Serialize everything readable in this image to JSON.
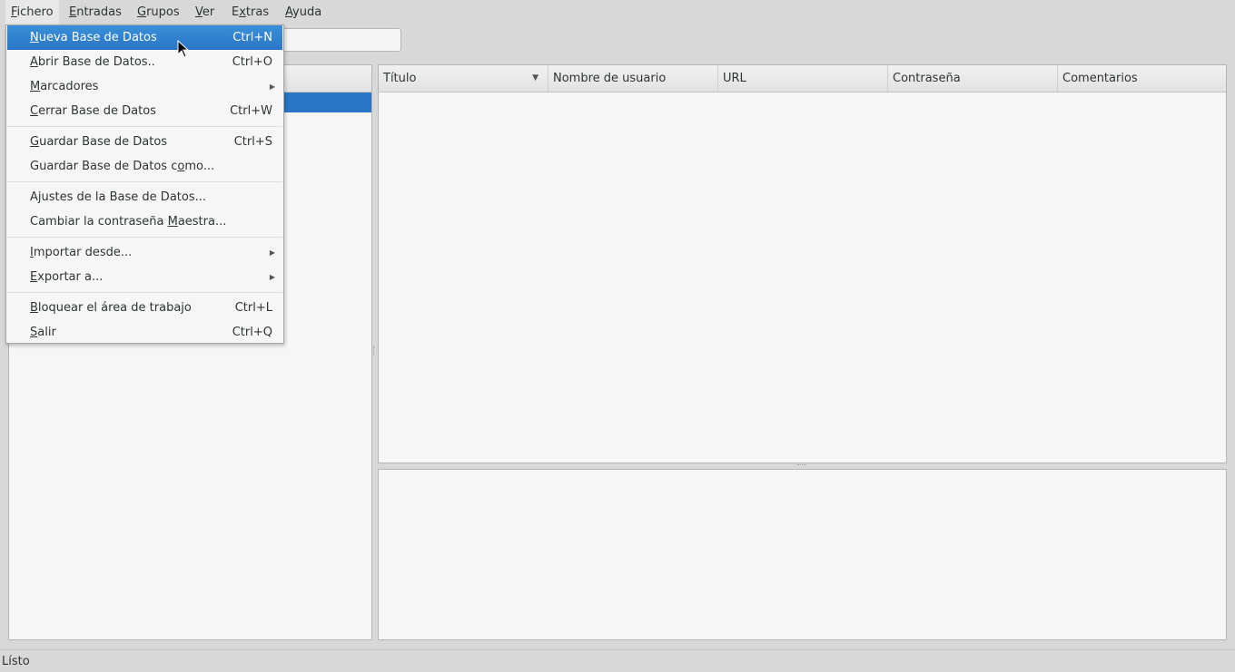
{
  "menubar": {
    "items": [
      {
        "pre": "",
        "mn": "F",
        "post": "ichero"
      },
      {
        "pre": "",
        "mn": "E",
        "post": "ntradas"
      },
      {
        "pre": "",
        "mn": "G",
        "post": "rupos"
      },
      {
        "pre": "",
        "mn": "V",
        "post": "er"
      },
      {
        "pre": "E",
        "mn": "x",
        "post": "tras"
      },
      {
        "pre": "",
        "mn": "A",
        "post": "yuda"
      }
    ]
  },
  "file_menu": {
    "items": [
      {
        "pre": "",
        "mn": "N",
        "post": "ueva Base de Datos",
        "shortcut": "Ctrl+N",
        "highlighted": true
      },
      {
        "pre": "",
        "mn": "A",
        "post": "brir Base de Datos..",
        "shortcut": "Ctrl+O"
      },
      {
        "pre": "",
        "mn": "M",
        "post": "arcadores",
        "submenu": true
      },
      {
        "pre": "",
        "mn": "C",
        "post": "errar Base de Datos",
        "shortcut": "Ctrl+W"
      },
      {
        "pre": "",
        "mn": "G",
        "post": "uardar Base de Datos",
        "shortcut": "Ctrl+S"
      },
      {
        "pre": "Guardar Base de Datos c",
        "mn": "o",
        "post": "mo...",
        "shortcut": ""
      },
      {
        "pre": "A",
        "mn": "j",
        "post": "ustes de la Base de Datos...",
        "shortcut": ""
      },
      {
        "pre": "Cambiar la contraseña ",
        "mn": "M",
        "post": "aestra...",
        "shortcut": ""
      },
      {
        "pre": "",
        "mn": "I",
        "post": "mportar desde...",
        "submenu": true
      },
      {
        "pre": "",
        "mn": "E",
        "post": "xportar a...",
        "submenu": true
      },
      {
        "pre": "",
        "mn": "B",
        "post": "loquear el área de trabajo",
        "shortcut": "Ctrl+L"
      },
      {
        "pre": "",
        "mn": "S",
        "post": "alir",
        "shortcut": "Ctrl+Q"
      }
    ]
  },
  "entries_table": {
    "columns": [
      "Título",
      "Nombre de usuario",
      "URL",
      "Contraseña",
      "Comentarios"
    ],
    "sort_icon": "sort-descending-icon"
  },
  "statusbar": {
    "text": "Lísto"
  },
  "colors": {
    "highlight": "#2a76c6",
    "background": "#d8d8d8",
    "panel": "#f6f6f6"
  }
}
